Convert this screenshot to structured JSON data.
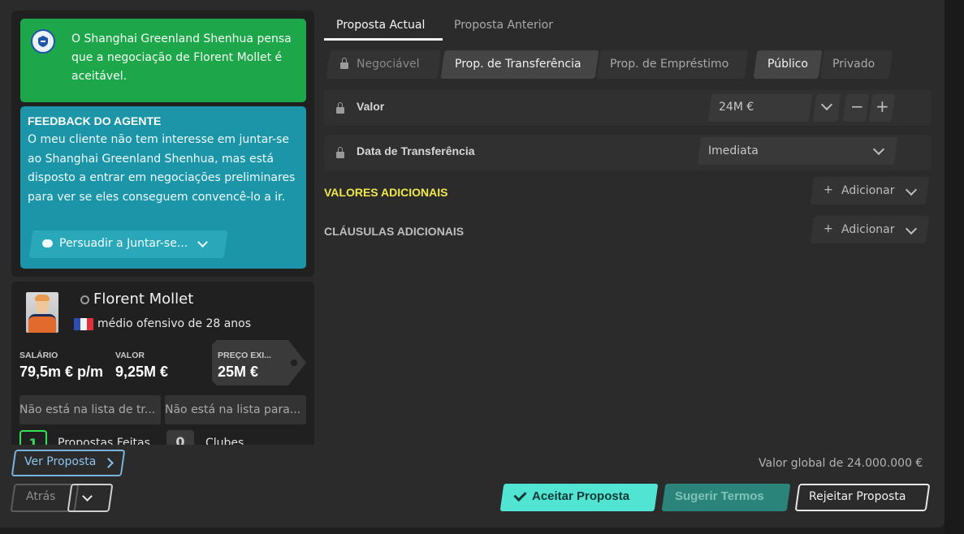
{
  "assistant_msg": "O Shanghai Greenland Shenhua pensa que a negociação de Florent Mollet é aceitável.",
  "agent_feedback": {
    "title": "FEEDBACK DO AGENTE",
    "text": "O meu cliente não tem interesse em juntar-se ao Shanghai Greenland Shenhua, mas está disposto a entrar em negociações preliminares para ver se eles conseguem convencê-lo a ir.",
    "persuade_label": "Persuadir a Juntar-se..."
  },
  "player": {
    "name": "Florent Mollet",
    "description": "médio ofensivo de 28 anos",
    "salary_label": "SALÁRIO",
    "salary_value": "79,5m € p/m",
    "value_label": "VALOR",
    "value_value": "9,25M €",
    "asking_label": "PREÇO EXI...",
    "asking_value": "25M €",
    "transfer_list_status": "Não está na lista de tr...",
    "loan_list_status": "Não está na lista para...",
    "offers_count": "1",
    "offers_label": "Propostas Feitas",
    "clubs_count": "0",
    "clubs_label": "Clubes"
  },
  "nav": {
    "view_offer": "Ver Proposta",
    "back": "Atrás"
  },
  "tabs": [
    {
      "label": "Proposta Actual",
      "active": true
    },
    {
      "label": "Proposta Anterior",
      "active": false
    }
  ],
  "offer_types": {
    "negotiable": "Negociável",
    "transfer": "Prop. de Transferência",
    "loan": "Prop. de Empréstimo",
    "public": "Público",
    "private": "Privado"
  },
  "fields": {
    "value_label": "Valor",
    "value_amount": "24M €",
    "date_label": "Data de Transferência",
    "date_value": "Imediata"
  },
  "sections": {
    "additional_values": "VALORES ADICIONAIS",
    "additional_clauses": "CLÁUSULAS ADICIONAIS",
    "add_label": "Adicionar"
  },
  "footer": {
    "global_value": "Valor global de 24.000.000 €",
    "accept": "Aceitar Proposta",
    "suggest": "Sugerir Termos",
    "reject": "Rejeitar Proposta"
  },
  "colors": {
    "green": "#1ea74a",
    "teal": "#1b95a7",
    "accept": "#52e4d3",
    "highlight_yellow": "#f0e84a"
  }
}
